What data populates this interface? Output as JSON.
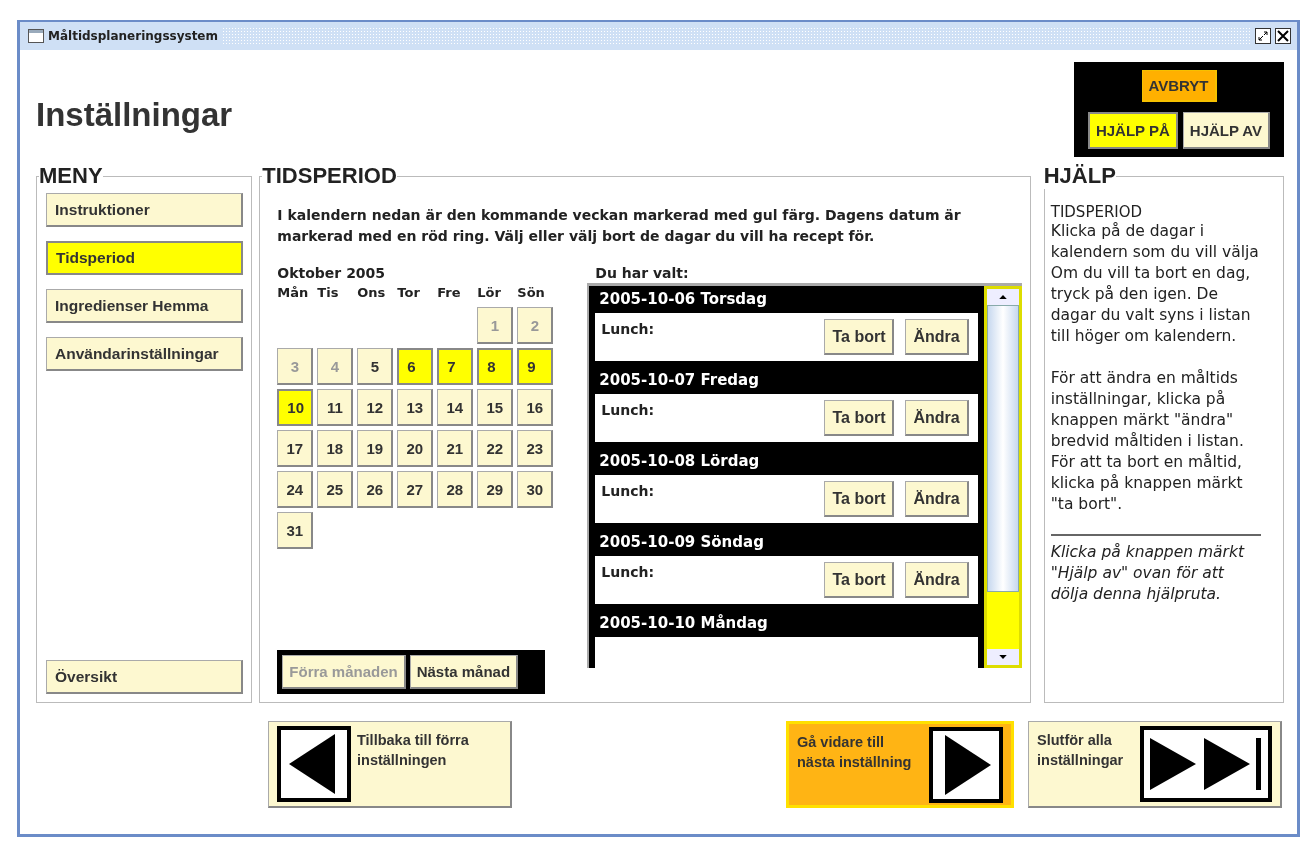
{
  "window": {
    "title": "Måltidsplaneringssystem"
  },
  "page_title": "Inställningar",
  "top_actions": {
    "cancel": "AVBRYT",
    "help_toggle": [
      {
        "label": "HJÄLP PÅ",
        "selected": true
      },
      {
        "label": "HJÄLP AV",
        "selected": false
      }
    ]
  },
  "menu": {
    "title": "MENY",
    "items": [
      {
        "label": "Instruktioner",
        "selected": false
      },
      {
        "label": "Tidsperiod",
        "selected": true
      },
      {
        "label": "Ingredienser Hemma",
        "selected": false
      },
      {
        "label": "Användarinställningar",
        "selected": false
      }
    ],
    "bottom_item": "Översikt"
  },
  "period": {
    "title": "TIDSPERIOD",
    "intro": "I kalendern nedan är den kommande veckan markerad med gul färg. Dagens datum är markerad med en röd ring. Välj eller välj bort de dagar du vill ha recept för.",
    "calendar": {
      "month": "Oktober 2005",
      "weekdays": [
        "Mån",
        "Tis",
        "Ons",
        "Tor",
        "Fre",
        "Lör",
        "Sön"
      ],
      "days": [
        {
          "label": "1",
          "selected": false,
          "disabled": true
        },
        {
          "label": "2",
          "selected": false,
          "disabled": true
        },
        {
          "label": "3",
          "selected": false,
          "disabled": true
        },
        {
          "label": "4",
          "selected": false,
          "disabled": true
        },
        {
          "label": "5",
          "selected": false,
          "disabled": false
        },
        {
          "label": "6",
          "selected": true,
          "disabled": false
        },
        {
          "label": "7",
          "selected": true,
          "disabled": false
        },
        {
          "label": "8",
          "selected": true,
          "disabled": false
        },
        {
          "label": "9",
          "selected": true,
          "disabled": false
        },
        {
          "label": "10",
          "selected": true,
          "disabled": false
        },
        {
          "label": "11",
          "selected": false,
          "disabled": false
        },
        {
          "label": "12",
          "selected": false,
          "disabled": false
        },
        {
          "label": "13",
          "selected": false,
          "disabled": false
        },
        {
          "label": "14",
          "selected": false,
          "disabled": false
        },
        {
          "label": "15",
          "selected": false,
          "disabled": false
        },
        {
          "label": "16",
          "selected": false,
          "disabled": false
        },
        {
          "label": "17",
          "selected": false,
          "disabled": false
        },
        {
          "label": "18",
          "selected": false,
          "disabled": false
        },
        {
          "label": "19",
          "selected": false,
          "disabled": false
        },
        {
          "label": "20",
          "selected": false,
          "disabled": false
        },
        {
          "label": "21",
          "selected": false,
          "disabled": false
        },
        {
          "label": "22",
          "selected": false,
          "disabled": false
        },
        {
          "label": "23",
          "selected": false,
          "disabled": false
        },
        {
          "label": "24",
          "selected": false,
          "disabled": false
        },
        {
          "label": "25",
          "selected": false,
          "disabled": false
        },
        {
          "label": "26",
          "selected": false,
          "disabled": false
        },
        {
          "label": "27",
          "selected": false,
          "disabled": false
        },
        {
          "label": "28",
          "selected": false,
          "disabled": false
        },
        {
          "label": "29",
          "selected": false,
          "disabled": false
        },
        {
          "label": "30",
          "selected": false,
          "disabled": false
        },
        {
          "label": "31",
          "selected": false,
          "disabled": false
        }
      ],
      "month_buttons": [
        {
          "label": "Förra månaden",
          "disabled": true
        },
        {
          "label": "Nästa månad",
          "disabled": false
        }
      ]
    },
    "chosen": {
      "title": "Du har valt:",
      "days": [
        {
          "date": "2005-10-06 Torsdag",
          "meal": "Lunch:",
          "buttons": [
            "Ta bort",
            "Ändra"
          ]
        },
        {
          "date": "2005-10-07 Fredag",
          "meal": "Lunch:",
          "buttons": [
            "Ta bort",
            "Ändra"
          ]
        },
        {
          "date": "2005-10-08 Lördag",
          "meal": "Lunch:",
          "buttons": [
            "Ta bort",
            "Ändra"
          ]
        },
        {
          "date": "2005-10-09 Söndag",
          "meal": "Lunch:",
          "buttons": [
            "Ta bort",
            "Ändra"
          ]
        },
        {
          "date": "2005-10-10 Måndag"
        }
      ]
    }
  },
  "help": {
    "title": "HJÄLP",
    "heading": "TIDSPERIOD",
    "paragraphs": [
      "Klicka på de dagar i kalendern som du vill välja Om du vill ta bort en dag, tryck på den igen. De dagar du valt syns i listan till höger om kalendern.",
      "För att ändra en måltids inställningar, klicka på knappen märkt \"ändra\" bredvid måltiden i listan. För att ta bort en måltid, klicka på knappen märkt \"ta bort\"."
    ],
    "note": "Klicka på knappen märkt \"Hjälp av\" ovan för att dölja denna hjälpruta."
  },
  "navigation": [
    {
      "kind": "back",
      "label": "Tillbaka till förra inställningen",
      "selected": false
    },
    {
      "kind": "next",
      "label": "Gå vidare till nästa inställning",
      "selected": true
    },
    {
      "kind": "finish",
      "label": "Slutför alla inställningar",
      "selected": false
    }
  ]
}
